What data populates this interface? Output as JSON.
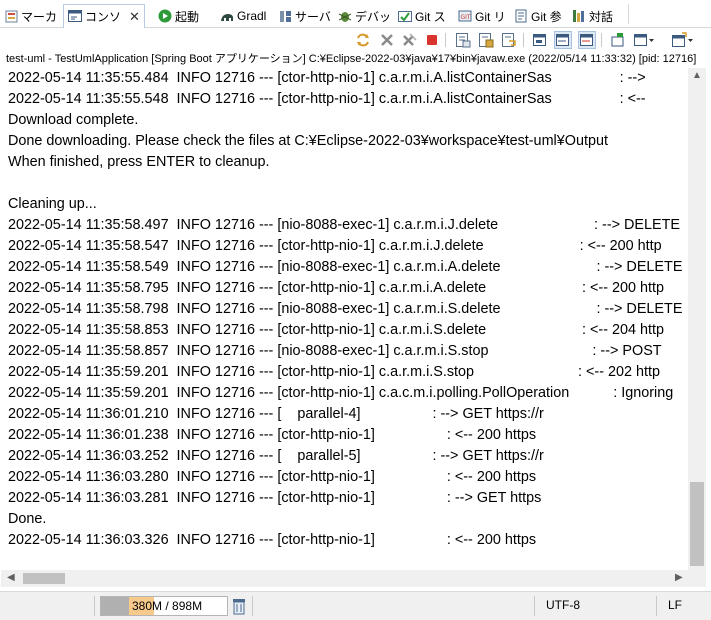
{
  "tabs": [
    {
      "label": "マーカ",
      "icon": "markers-icon"
    },
    {
      "label": "コンソ",
      "icon": "console-icon",
      "active": true
    },
    {
      "label": "起動",
      "icon": "launch-icon"
    },
    {
      "label": "Gradl",
      "icon": "gradle-icon"
    },
    {
      "label": "サーバ",
      "icon": "servers-icon"
    },
    {
      "label": "デバッ",
      "icon": "debug-icon"
    },
    {
      "label": "Git ス",
      "icon": "git-staging-icon"
    },
    {
      "label": "Git リ",
      "icon": "git-repositories-icon"
    },
    {
      "label": "Git 参",
      "icon": "git-reflog-icon"
    },
    {
      "label": "対話",
      "icon": "interactive-icon"
    }
  ],
  "process_line": "test-uml - TestUmlApplication [Spring Boot アプリケーション] C:¥Eclipse-2022-03¥java¥17¥bin¥javaw.exe  (2022/05/14 11:33:32) [pid: 12716]",
  "console_lines": [
    "2022-05-14 11:35:55.484  INFO 12716 --- [ctor-http-nio-1] c.a.r.m.i.A.listContainerSas                 : --> ",
    "2022-05-14 11:35:55.548  INFO 12716 --- [ctor-http-nio-1] c.a.r.m.i.A.listContainerSas                 : <-- ",
    "Download complete.",
    "Done downloading. Please check the files at C:¥Eclipse-2022-03¥workspace¥test-uml¥Output",
    "When finished, press ENTER to cleanup.",
    "",
    "Cleaning up...",
    "2022-05-14 11:35:58.497  INFO 12716 --- [nio-8088-exec-1] c.a.r.m.i.J.delete                        : --> DELETE",
    "2022-05-14 11:35:58.547  INFO 12716 --- [ctor-http-nio-1] c.a.r.m.i.J.delete                        : <-- 200 http",
    "2022-05-14 11:35:58.549  INFO 12716 --- [nio-8088-exec-1] c.a.r.m.i.A.delete                        : --> DELETE",
    "2022-05-14 11:35:58.795  INFO 12716 --- [ctor-http-nio-1] c.a.r.m.i.A.delete                        : <-- 200 http",
    "2022-05-14 11:35:58.798  INFO 12716 --- [nio-8088-exec-1] c.a.r.m.i.S.delete                        : --> DELETE",
    "2022-05-14 11:35:58.853  INFO 12716 --- [ctor-http-nio-1] c.a.r.m.i.S.delete                        : <-- 204 http",
    "2022-05-14 11:35:58.857  INFO 12716 --- [nio-8088-exec-1] c.a.r.m.i.S.stop                          : --> POST",
    "2022-05-14 11:35:59.201  INFO 12716 --- [ctor-http-nio-1] c.a.r.m.i.S.stop                          : <-- 202 http",
    "2022-05-14 11:35:59.201  INFO 12716 --- [ctor-http-nio-1] c.a.c.m.i.polling.PollOperation           : Ignoring",
    "2022-05-14 11:36:01.210  INFO 12716 --- [    parallel-4]                  : --> GET https://r",
    "2022-05-14 11:36:01.238  INFO 12716 --- [ctor-http-nio-1]                  : <-- 200 https",
    "2022-05-14 11:36:03.252  INFO 12716 --- [    parallel-5]                  : --> GET https://r",
    "2022-05-14 11:36:03.280  INFO 12716 --- [ctor-http-nio-1]                  : <-- 200 https",
    "2022-05-14 11:36:03.281  INFO 12716 --- [ctor-http-nio-1]                  : --> GET https",
    "Done.",
    "2022-05-14 11:36:03.326  INFO 12716 --- [ctor-http-nio-1]                  : <-- 200 https"
  ],
  "status": {
    "heap_used": "380M",
    "heap_sep": " / ",
    "heap_total": "898M",
    "heap_fraction": 0.42,
    "encoding": "UTF-8",
    "line_delimiter": "LF"
  },
  "colors": {
    "accent": "#f7c98a",
    "stop_red": "#d9342b"
  }
}
